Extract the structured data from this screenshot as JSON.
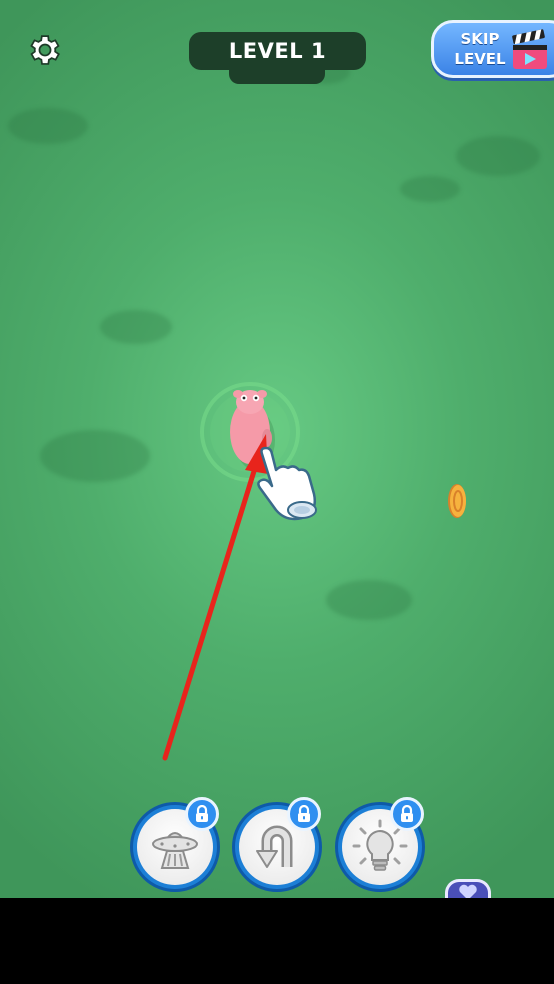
{
  "header": {
    "settings_icon": "gear-icon",
    "level_label": "LEVEL 1",
    "skip_line1": "SKIP",
    "skip_line2": "LEVEL",
    "skip_icon": "clapperboard-play-icon"
  },
  "scene": {
    "background_color": "#4fae6c",
    "character_color": "#f59aa8",
    "arrow_color": "#e8241c",
    "coin_color": "#f2a23a"
  },
  "powerups": [
    {
      "icon": "ufo-icon",
      "locked": true
    },
    {
      "icon": "u-turn-arrow-icon",
      "locked": true
    },
    {
      "icon": "lightbulb-icon",
      "locked": true
    }
  ],
  "colors": {
    "accent_blue": "#2f8ff0",
    "banner_dark": "#1d3f29"
  }
}
